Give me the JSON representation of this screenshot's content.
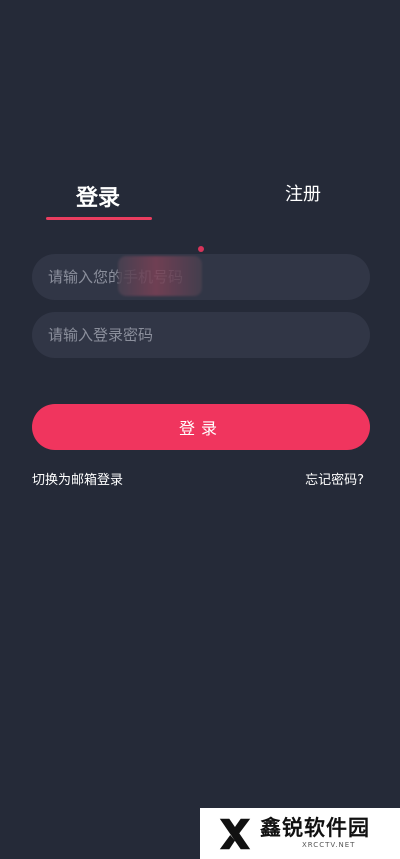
{
  "tabs": {
    "login_label": "登录",
    "register_label": "注册"
  },
  "form": {
    "phone_placeholder": "请输入您的手机号码",
    "password_placeholder": "请输入登录密码",
    "submit_label": "登录"
  },
  "links": {
    "switch_to_email": "切换为邮箱登录",
    "forgot_password": "忘记密码?"
  },
  "watermark": {
    "name": "鑫锐软件园",
    "domain": "XRCCTV.NET"
  },
  "colors": {
    "background": "#252a38",
    "accent": "#f0355e",
    "field": "#313646"
  }
}
